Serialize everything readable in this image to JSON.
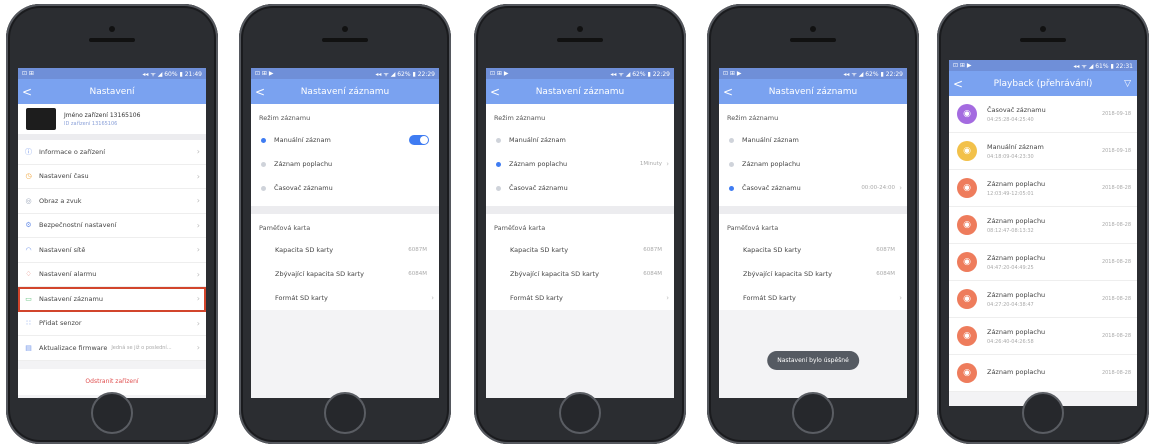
{
  "screens": [
    {
      "status": {
        "left": "⊡ ⊞",
        "right": "◂◂ ᯤ ◢ 60% ▮ 21:49"
      },
      "title": "Nastavení",
      "back": "<",
      "device": {
        "name": "Jméno zařízení 13165106",
        "id": "ID zařízení 13165106"
      },
      "menu": [
        {
          "icon": "info-icon",
          "glyph": "ⓘ",
          "color": "#6f93e8",
          "label": "Informace o zařízení"
        },
        {
          "icon": "clock-icon",
          "glyph": "◷",
          "color": "#f0a43a",
          "label": "Nastavení času"
        },
        {
          "icon": "image-icon",
          "glyph": "◎",
          "color": "#9aa5b8",
          "label": "Obraz a zvuk"
        },
        {
          "icon": "security-icon",
          "glyph": "⚙",
          "color": "#6f93e8",
          "label": "Bezpečnostní nastavení"
        },
        {
          "icon": "wifi-icon",
          "glyph": "◠",
          "color": "#6f93e8",
          "label": "Nastavení sítě"
        },
        {
          "icon": "alarm-icon",
          "glyph": "♢",
          "color": "#e06a5a",
          "label": "Nastavení alarmu"
        },
        {
          "icon": "record-icon",
          "glyph": "▭",
          "color": "#5ec07a",
          "label": "Nastavení záznamu",
          "highlight": true
        },
        {
          "icon": "sensor-icon",
          "glyph": "∷",
          "color": "#6f93e8",
          "label": "Přidat senzor"
        },
        {
          "icon": "firmware-icon",
          "glyph": "▤",
          "color": "#6f93e8",
          "label": "Aktualizace firmware",
          "hint": "Jedná se již o poslední..."
        }
      ],
      "delete_label": "Odstranit zařízení"
    },
    {
      "status": {
        "left": "⊡ ⊞ ▶",
        "right": "◂◂ ᯤ ◢ 62% ▮ 22:29"
      },
      "title": "Nastavení záznamu",
      "back": "<",
      "mode_title": "Režim záznamu",
      "modes": [
        "Manuální záznam",
        "Záznam poplachu",
        "Časovač záznamu"
      ],
      "card_title": "Paměťová karta",
      "card_rows": [
        {
          "label": "Kapacita SD karty",
          "value": "6087M"
        },
        {
          "label": "Zbývající kapacita SD karty",
          "value": "6084M"
        },
        {
          "label": "Formát SD karty",
          "value": ""
        }
      ]
    },
    {
      "status": {
        "left": "⊡ ⊞ ▶",
        "right": "◂◂ ᯤ ◢ 62% ▮ 22:29"
      },
      "title": "Nastavení záznamu",
      "back": "<",
      "mode_title": "Režim záznamu",
      "modes": [
        "Manuální záznam",
        "Záznam poplachu",
        "Časovač záznamu"
      ],
      "alarm_value": "1Minuty",
      "card_title": "Paměťová karta",
      "card_rows": [
        {
          "label": "Kapacita SD karty",
          "value": "6087M"
        },
        {
          "label": "Zbývající kapacita SD karty",
          "value": "6084M"
        },
        {
          "label": "Formát SD karty",
          "value": ""
        }
      ]
    },
    {
      "status": {
        "left": "⊡ ⊞ ▶",
        "right": "◂◂ ᯤ ◢ 62% ▮ 22:29"
      },
      "title": "Nastavení záznamu",
      "back": "<",
      "mode_title": "Režim záznamu",
      "modes": [
        "Manuální záznam",
        "Záznam poplachu",
        "Časovač záznamu"
      ],
      "timer_value": "00:00-24:00",
      "card_title": "Paměťová karta",
      "card_rows": [
        {
          "label": "Kapacita SD karty",
          "value": "6087M"
        },
        {
          "label": "Zbývající kapacita SD karty",
          "value": "6084M"
        },
        {
          "label": "Formát SD karty",
          "value": ""
        }
      ],
      "toast": "Nastavení bylo úspěšné"
    },
    {
      "status": {
        "left": "⊡ ⊞ ▶",
        "right": "◂◂ ᯤ ◢ 61% ▮ 22:31"
      },
      "title": "Playback (přehrávání)",
      "back": "<",
      "filter": "▽",
      "items": [
        {
          "title": "Časovač záznamu",
          "time": "04:25:28-04:25:40",
          "date": "2018-09-18",
          "color": "#a46be0",
          "icon": "record-timer-icon"
        },
        {
          "title": "Manuální záznam",
          "time": "04:18:09-04:23:30",
          "date": "2018-09-18",
          "color": "#f2c14a",
          "icon": "record-manual-icon"
        },
        {
          "title": "Záznam poplachu",
          "time": "12:03:49-12:05:01",
          "date": "2018-08-28",
          "color": "#ee7c5c",
          "icon": "record-alarm-icon"
        },
        {
          "title": "Záznam poplachu",
          "time": "08:12:47-08:13:32",
          "date": "2018-08-28",
          "color": "#ee7c5c",
          "icon": "record-alarm-icon"
        },
        {
          "title": "Záznam poplachu",
          "time": "04:47:20-04:49:25",
          "date": "2018-08-28",
          "color": "#ee7c5c",
          "icon": "record-alarm-icon"
        },
        {
          "title": "Záznam poplachu",
          "time": "04:27:20-04:38:47",
          "date": "2018-08-28",
          "color": "#ee7c5c",
          "icon": "record-alarm-icon"
        },
        {
          "title": "Záznam poplachu",
          "time": "04:26:40-04:26:58",
          "date": "2018-08-28",
          "color": "#ee7c5c",
          "icon": "record-alarm-icon"
        },
        {
          "title": "Záznam poplachu",
          "time": "",
          "date": "2018-08-28",
          "color": "#ee7c5c",
          "icon": "record-alarm-icon"
        }
      ]
    }
  ]
}
